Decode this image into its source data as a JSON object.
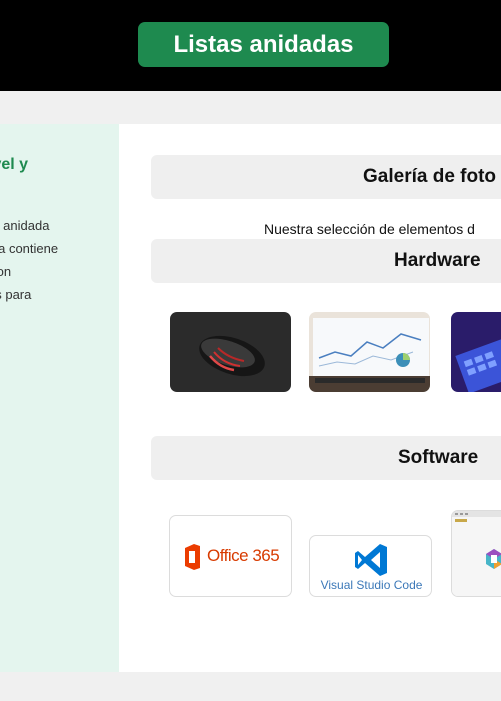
{
  "header": {
    "title": "Listas anidadas"
  },
  "aside": {
    "heading": "ivel y",
    "lines": [
      "ra anidada",
      "sta contiene",
      "Son",
      "es para"
    ]
  },
  "gallery": {
    "title": "Galería de foto",
    "intro": "Nuestra selección de elementos d",
    "sections": [
      {
        "title": "Hardware",
        "items": [
          "mouse-photo",
          "laptop-analytics-photo",
          "keyboard-photo"
        ]
      },
      {
        "title": "Software",
        "items": [
          {
            "name": "Office 365"
          },
          {
            "name": "Visual Studio Code"
          },
          {
            "name": "app-window-logo"
          }
        ]
      }
    ]
  },
  "colors": {
    "accent": "#1e8a4f",
    "header_bg": "#000000",
    "aside_bg": "#e4f5ee",
    "section_bg": "#efefef"
  }
}
